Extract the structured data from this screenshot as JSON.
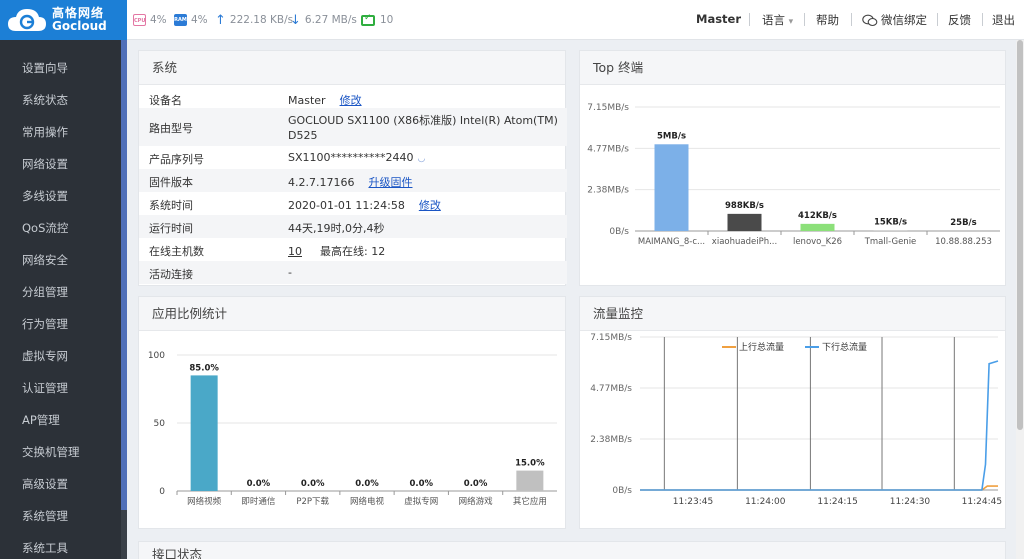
{
  "brand": {
    "name_cn": "高恪网络",
    "name_en": "Gocloud"
  },
  "nav": [
    "设置向导",
    "系统状态",
    "常用操作",
    "网络设置",
    "多线设置",
    "QoS流控",
    "网络安全",
    "分组管理",
    "行为管理",
    "虚拟专网",
    "认证管理",
    "AP管理",
    "交换机管理",
    "高级设置",
    "系统管理",
    "系统工具"
  ],
  "topbar": {
    "cpu_badge": "CPU",
    "cpu": "4%",
    "ram_badge": "RAM",
    "ram": "4%",
    "up_arrow": "↑",
    "up": "222.18 KB/s",
    "down_arrow": "↓",
    "down": "6.27 MB/s",
    "online": "10",
    "device": "Master",
    "lang": "语言",
    "lang_caret": "▾",
    "help": "帮助",
    "wechat": "微信绑定",
    "feedback": "反馈",
    "logout": "退出"
  },
  "system": {
    "title": "系统",
    "rows": [
      {
        "label": "设备名",
        "value": "Master",
        "link": "修改"
      },
      {
        "label": "路由型号",
        "value": "GOCLOUD SX1100 (X86标准版) Intel(R) Atom(TM)",
        "value2": "D525"
      },
      {
        "label": "产品序列号",
        "value": "SX1100**********2440"
      },
      {
        "label": "固件版本",
        "value": "4.2.7.17166",
        "link": "升级固件"
      },
      {
        "label": "系统时间",
        "value": "2020-01-01 11:24:58",
        "link": "修改"
      },
      {
        "label": "运行时间",
        "value": "44天,19时,0分,4秒"
      },
      {
        "label": "在线主机数",
        "value": "10",
        "extra_label": "最高在线:",
        "extra_value": "12"
      },
      {
        "label": "活动连接",
        "value": "-"
      }
    ]
  },
  "top_panel_title": "Top 终端",
  "app_panel_title": "应用比例统计",
  "traffic_panel_title": "流量监控",
  "next_panel_title": "接口状态",
  "chart_data": [
    {
      "type": "bar",
      "categories": [
        "MAIMANG_8-c...",
        "xiaohuadeiPh...",
        "lenovo_K26",
        "Tmall-Genie",
        "10.88.88.253"
      ],
      "values_mbps": [
        5,
        0.988,
        0.412,
        0.015,
        2.5e-05
      ],
      "data_labels": [
        "5MB/s",
        "988KB/s",
        "412KB/s",
        "15KB/s",
        "25B/s"
      ],
      "colors": [
        "#7cb0e8",
        "#4a4a4a",
        "#8ce07a",
        "#bbbbbb",
        "#bbbbbb"
      ],
      "y_ticks": [
        "7.15MB/s",
        "4.77MB/s",
        "2.38MB/s",
        "0B/s"
      ],
      "ylim": [
        0,
        7.15
      ]
    },
    {
      "type": "bar",
      "categories": [
        "网络视频",
        "即时通信",
        "P2P下载",
        "网络电视",
        "虚拟专网",
        "网络游戏",
        "其它应用"
      ],
      "values": [
        85,
        0,
        0,
        0,
        0,
        0,
        15
      ],
      "data_labels": [
        "85.0%",
        "0.0%",
        "0.0%",
        "0.0%",
        "0.0%",
        "0.0%",
        "15.0%"
      ],
      "colors": [
        "#4aa8c8",
        "#4aa8c8",
        "#4aa8c8",
        "#4aa8c8",
        "#4aa8c8",
        "#4aa8c8",
        "#c0c0c0"
      ],
      "y_ticks": [
        "100",
        "50",
        "0"
      ],
      "ylim": [
        0,
        100
      ]
    },
    {
      "type": "line",
      "y_ticks": [
        "7.15MB/s",
        "4.77MB/s",
        "2.38MB/s",
        "0B/s"
      ],
      "ylim": [
        0,
        7.15
      ],
      "x_ticks": [
        "11:23:45",
        "11:24:00",
        "11:24:15",
        "11:24:30",
        "11:24:45"
      ],
      "series": [
        {
          "name": "上行总流量",
          "color": "#f0a040",
          "points": [
            [
              0,
              0
            ],
            [
              0.955,
              0
            ],
            [
              0.97,
              0.18
            ],
            [
              1,
              0.18
            ]
          ]
        },
        {
          "name": "下行总流量",
          "color": "#4a9ee8",
          "points": [
            [
              0,
              0
            ],
            [
              0.955,
              0
            ],
            [
              0.965,
              1.2
            ],
            [
              0.975,
              5.9
            ],
            [
              1,
              6.03
            ]
          ]
        }
      ]
    }
  ]
}
